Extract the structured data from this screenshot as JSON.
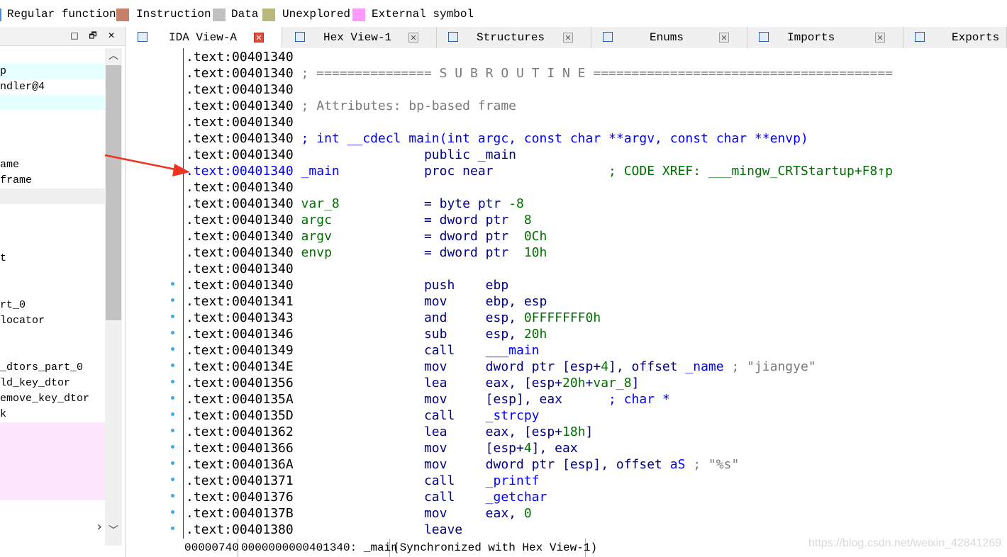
{
  "legend": [
    {
      "label": "Regular function",
      "color": "#4a8ad8"
    },
    {
      "label": "Instruction",
      "color": "#c48068"
    },
    {
      "label": "Data",
      "color": "#c0c0c0"
    },
    {
      "label": "Unexplored",
      "color": "#b8b87a"
    },
    {
      "label": "External symbol",
      "color": "#ff99ff"
    }
  ],
  "left_panel": {
    "buttons": [
      "□",
      "🗗",
      "✕"
    ],
    "rows": [
      {
        "text": "",
        "bg": "#ffffff"
      },
      {
        "text": "p",
        "bg": "#e6ffff"
      },
      {
        "text": "ndler@4",
        "bg": "#ffffff"
      },
      {
        "text": "",
        "bg": "#e6ffff"
      },
      {
        "text": "",
        "bg": "#ffffff"
      },
      {
        "text": "",
        "bg": "#ffffff"
      },
      {
        "text": "",
        "bg": "#ffffff"
      },
      {
        "text": "ame",
        "bg": "#ffffff"
      },
      {
        "text": "frame",
        "bg": "#ffffff"
      },
      {
        "text": "",
        "bg": "#f0f0f0"
      },
      {
        "text": "",
        "bg": "#ffffff"
      },
      {
        "text": "",
        "bg": "#ffffff"
      },
      {
        "text": "",
        "bg": "#ffffff"
      },
      {
        "text": "t",
        "bg": "#ffffff"
      },
      {
        "text": "",
        "bg": "#ffffff"
      },
      {
        "text": "",
        "bg": "#ffffff"
      },
      {
        "text": "rt_0",
        "bg": "#ffffff"
      },
      {
        "text": "locator",
        "bg": "#ffffff"
      },
      {
        "text": "",
        "bg": "#ffffff"
      },
      {
        "text": "",
        "bg": "#ffffff"
      },
      {
        "text": "_dtors_part_0",
        "bg": "#ffffff"
      },
      {
        "text": "ld_key_dtor",
        "bg": "#ffffff"
      },
      {
        "text": "emove_key_dtor",
        "bg": "#ffffff"
      },
      {
        "text": "k",
        "bg": "#ffffff"
      },
      {
        "text": "",
        "bg": "#ffe6ff"
      },
      {
        "text": "",
        "bg": "#ffe6ff"
      },
      {
        "text": "",
        "bg": "#ffe6ff"
      },
      {
        "text": "",
        "bg": "#ffe6ff"
      },
      {
        "text": "",
        "bg": "#ffe6ff"
      }
    ],
    "scroll_up": "︿",
    "scroll_down": "﹀",
    "scroll_right": "›"
  },
  "tabs": [
    {
      "label": "IDA View-A",
      "active": true
    },
    {
      "label": "Hex View-1",
      "active": false
    },
    {
      "label": "Structures",
      "active": false
    },
    {
      "label": "Enums",
      "active": false
    },
    {
      "label": "Imports",
      "active": false
    },
    {
      "label": "Exports",
      "active": false
    }
  ],
  "lines": [
    {
      "addr": ".text:00401340",
      "dot": false,
      "parts": []
    },
    {
      "addr": ".text:00401340",
      "dot": false,
      "parts": [
        {
          "t": " ; =============== S U B R O U T I N E =======================================",
          "c": "c-comment"
        }
      ]
    },
    {
      "addr": ".text:00401340",
      "dot": false,
      "parts": []
    },
    {
      "addr": ".text:00401340",
      "dot": false,
      "parts": [
        {
          "t": " ; Attributes: bp-based frame",
          "c": "c-comment"
        }
      ]
    },
    {
      "addr": ".text:00401340",
      "dot": false,
      "parts": []
    },
    {
      "addr": ".text:00401340",
      "dot": false,
      "parts": [
        {
          "t": " ; int __cdecl main(int argc, const char **argv, const char **envp)",
          "c": "c-blue"
        }
      ]
    },
    {
      "addr": ".text:00401340",
      "dot": false,
      "parts": [
        {
          "t": "                 public _main",
          "c": "c-navy"
        }
      ]
    },
    {
      "addr": ".text:00401340",
      "dot": false,
      "cur": true,
      "parts": [
        {
          "t": " _main",
          "c": "c-blue"
        },
        {
          "t": "           proc near               ",
          "c": "c-navy"
        },
        {
          "t": "; CODE XREF: ___mingw_CRTStartup+F8↑p",
          "c": "c-green"
        }
      ]
    },
    {
      "addr": ".text:00401340",
      "dot": false,
      "parts": []
    },
    {
      "addr": ".text:00401340",
      "dot": false,
      "parts": [
        {
          "t": " var_8",
          "c": "c-green"
        },
        {
          "t": "           = byte ptr ",
          "c": "c-navy"
        },
        {
          "t": "-8",
          "c": "c-num"
        }
      ]
    },
    {
      "addr": ".text:00401340",
      "dot": false,
      "parts": [
        {
          "t": " argc",
          "c": "c-green"
        },
        {
          "t": "            = dword ptr  ",
          "c": "c-navy"
        },
        {
          "t": "8",
          "c": "c-num"
        }
      ]
    },
    {
      "addr": ".text:00401340",
      "dot": false,
      "parts": [
        {
          "t": " argv",
          "c": "c-green"
        },
        {
          "t": "            = dword ptr  ",
          "c": "c-navy"
        },
        {
          "t": "0Ch",
          "c": "c-num"
        }
      ]
    },
    {
      "addr": ".text:00401340",
      "dot": false,
      "parts": [
        {
          "t": " envp",
          "c": "c-green"
        },
        {
          "t": "            = dword ptr  ",
          "c": "c-navy"
        },
        {
          "t": "10h",
          "c": "c-num"
        }
      ]
    },
    {
      "addr": ".text:00401340",
      "dot": false,
      "parts": []
    },
    {
      "addr": ".text:00401340",
      "dot": true,
      "parts": [
        {
          "t": "                 push    ebp",
          "c": "c-navy"
        }
      ]
    },
    {
      "addr": ".text:00401341",
      "dot": true,
      "parts": [
        {
          "t": "                 mov     ebp, esp",
          "c": "c-navy"
        }
      ]
    },
    {
      "addr": ".text:00401343",
      "dot": true,
      "parts": [
        {
          "t": "                 and     esp, ",
          "c": "c-navy"
        },
        {
          "t": "0FFFFFFF0h",
          "c": "c-num"
        }
      ]
    },
    {
      "addr": ".text:00401346",
      "dot": true,
      "parts": [
        {
          "t": "                 sub     esp, ",
          "c": "c-navy"
        },
        {
          "t": "20h",
          "c": "c-num"
        }
      ]
    },
    {
      "addr": ".text:00401349",
      "dot": true,
      "parts": [
        {
          "t": "                 call    ",
          "c": "c-navy"
        },
        {
          "t": "___main",
          "c": "c-blue"
        }
      ]
    },
    {
      "addr": ".text:0040134E",
      "dot": true,
      "parts": [
        {
          "t": "                 mov     dword ptr [esp+",
          "c": "c-navy"
        },
        {
          "t": "4",
          "c": "c-num"
        },
        {
          "t": "], offset ",
          "c": "c-navy"
        },
        {
          "t": "_name",
          "c": "c-blue"
        },
        {
          "t": " ; \"jiangye\"",
          "c": "c-str"
        }
      ]
    },
    {
      "addr": ".text:00401356",
      "dot": true,
      "parts": [
        {
          "t": "                 lea     eax, [esp+",
          "c": "c-navy"
        },
        {
          "t": "20h",
          "c": "c-num"
        },
        {
          "t": "+",
          "c": "c-navy"
        },
        {
          "t": "var_8",
          "c": "c-green"
        },
        {
          "t": "]",
          "c": "c-navy"
        }
      ]
    },
    {
      "addr": ".text:0040135A",
      "dot": true,
      "parts": [
        {
          "t": "                 mov     [esp], eax      ",
          "c": "c-navy"
        },
        {
          "t": "; char *",
          "c": "c-blue"
        }
      ]
    },
    {
      "addr": ".text:0040135D",
      "dot": true,
      "parts": [
        {
          "t": "                 call    ",
          "c": "c-navy"
        },
        {
          "t": "_strcpy",
          "c": "c-blue"
        }
      ]
    },
    {
      "addr": ".text:00401362",
      "dot": true,
      "parts": [
        {
          "t": "                 lea     eax, [esp+",
          "c": "c-navy"
        },
        {
          "t": "18h",
          "c": "c-num"
        },
        {
          "t": "]",
          "c": "c-navy"
        }
      ]
    },
    {
      "addr": ".text:00401366",
      "dot": true,
      "parts": [
        {
          "t": "                 mov     [esp+",
          "c": "c-navy"
        },
        {
          "t": "4",
          "c": "c-num"
        },
        {
          "t": "], eax",
          "c": "c-navy"
        }
      ]
    },
    {
      "addr": ".text:0040136A",
      "dot": true,
      "parts": [
        {
          "t": "                 mov     dword ptr [esp], offset ",
          "c": "c-navy"
        },
        {
          "t": "aS",
          "c": "c-blue"
        },
        {
          "t": " ; \"%s\"",
          "c": "c-str"
        }
      ]
    },
    {
      "addr": ".text:00401371",
      "dot": true,
      "parts": [
        {
          "t": "                 call    ",
          "c": "c-navy"
        },
        {
          "t": "_printf",
          "c": "c-blue"
        }
      ]
    },
    {
      "addr": ".text:00401376",
      "dot": true,
      "parts": [
        {
          "t": "                 call    ",
          "c": "c-navy"
        },
        {
          "t": "_getchar",
          "c": "c-blue"
        }
      ]
    },
    {
      "addr": ".text:0040137B",
      "dot": true,
      "parts": [
        {
          "t": "                 mov     eax, ",
          "c": "c-navy"
        },
        {
          "t": "0",
          "c": "c-num"
        }
      ]
    },
    {
      "addr": ".text:00401380",
      "dot": true,
      "parts": [
        {
          "t": "                 leave",
          "c": "c-navy"
        }
      ]
    }
  ],
  "status": {
    "offset": "00000740",
    "address": "0000000000401340: _main",
    "sync": "(Synchronized with Hex View-1)"
  },
  "watermark": "https://blog.csdn.net/weixin_42841269"
}
